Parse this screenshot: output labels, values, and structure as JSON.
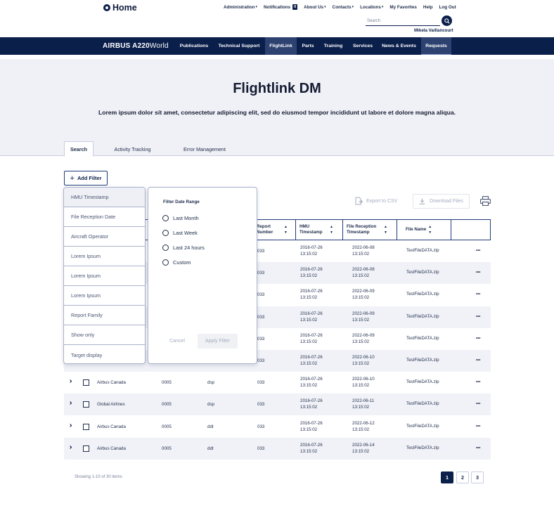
{
  "topbar": {
    "logo_text": "Home",
    "nav": [
      "Administration",
      "Notifications",
      "About Us",
      "Contacts",
      "Locations",
      "My Favorites",
      "Help",
      "Log Out"
    ],
    "notifications_count": "0",
    "search_placeholder": "Search",
    "user_name": "Mikela Vaillancourt"
  },
  "mainnav": {
    "brand_bold": "AIRBUS A220",
    "brand_light": "World",
    "items": [
      "Publications",
      "Technical Support",
      "FlightLink",
      "Parts",
      "Training",
      "Services",
      "News & Events",
      "Requests"
    ],
    "active_item": "FlightLink"
  },
  "hero": {
    "title": "Flightlink DM",
    "subtitle": "Lorem ipsum dolor sit amet, consectetur adipiscing elit, sed do eiusmod tempor incididunt ut labore et dolore magna aliqua."
  },
  "tabs": [
    "Search",
    "Activity Tracking",
    "Error Management"
  ],
  "add_filter_label": "Add Filter",
  "actions": {
    "export_label": "Export to CSV",
    "download_label": "Download Files"
  },
  "table": {
    "headers": {
      "report_number": "Report Number",
      "hmu_timestamp": "HMU Timestamp",
      "file_reception": "File Reception Timestamp",
      "file_name": "File Name"
    },
    "rows": [
      {
        "operator": "",
        "code": "",
        "type": "",
        "report": "033",
        "hmu_date": "2016-07-26",
        "hmu_time": "13:15:02",
        "rec_date": "2022-06-08",
        "rec_time": "13:15:02",
        "file": "TestFileDATA.zip"
      },
      {
        "operator": "",
        "code": "",
        "type": "",
        "report": "033",
        "hmu_date": "2016-07-26",
        "hmu_time": "13:15:02",
        "rec_date": "2022-06-08",
        "rec_time": "13:15:02",
        "file": "TestFileDATA.zip"
      },
      {
        "operator": "",
        "code": "",
        "type": "",
        "report": "033",
        "hmu_date": "2016-07-26",
        "hmu_time": "13:15:02",
        "rec_date": "2022-06-09",
        "rec_time": "13:15:02",
        "file": "TestFileDATA.zip"
      },
      {
        "operator": "",
        "code": "",
        "type": "",
        "report": "033",
        "hmu_date": "2016-07-26",
        "hmu_time": "13:15:02",
        "rec_date": "2022-06-09",
        "rec_time": "13:15:02",
        "file": "TestFileDATA.zip"
      },
      {
        "operator": "",
        "code": "",
        "type": "",
        "report": "033",
        "hmu_date": "2016-07-26",
        "hmu_time": "13:15:02",
        "rec_date": "2022-06-09",
        "rec_time": "13:15:02",
        "file": "TestFileDATA.zip"
      },
      {
        "operator": "",
        "code": "",
        "type": "",
        "report": "033",
        "hmu_date": "2016-07-26",
        "hmu_time": "13:15:02",
        "rec_date": "2022-06-10",
        "rec_time": "13:15:02",
        "file": "TestFileDATA.zip"
      },
      {
        "operator": "Airbus Canada",
        "code": "0005",
        "type": "dsp",
        "report": "033",
        "hmu_date": "2016-07-26",
        "hmu_time": "13:15:02",
        "rec_date": "2022-06-10",
        "rec_time": "13:15:02",
        "file": "TestFileDATA.zip"
      },
      {
        "operator": "Global Airlines",
        "code": "0005",
        "type": "dsp",
        "report": "033",
        "hmu_date": "2016-07-26",
        "hmu_time": "13:15:02",
        "rec_date": "2022-06-11",
        "rec_time": "13:15:02",
        "file": "TestFileDATA.zip"
      },
      {
        "operator": "Airbus Canada",
        "code": "0005",
        "type": "ddt",
        "report": "033",
        "hmu_date": "2016-07-26",
        "hmu_time": "13:15:02",
        "rec_date": "2022-06-12",
        "rec_time": "13:15:02",
        "file": "TestFileDATA.zip"
      },
      {
        "operator": "Airbus Canada",
        "code": "0005",
        "type": "ddt",
        "report": "033",
        "hmu_date": "2016-07-26",
        "hmu_time": "13:15:02",
        "rec_date": "2022-06-14",
        "rec_time": "13:15:02",
        "file": "TestFileDATA.zip"
      }
    ]
  },
  "filter_menu": {
    "items": [
      "HMU Timestamp",
      "File Reception Date",
      "Aircraft Operator",
      "Lorem Ipsum",
      "Lorem Ipsum",
      "Lorem Ipsum",
      "Report Family",
      "Show only",
      "Target display"
    ],
    "panel_title": "Filter Date Range",
    "options": [
      "Last Month",
      "Last Week",
      "Last 24 hours",
      "Custom"
    ],
    "cancel_label": "Cancel",
    "apply_label": "Apply Filter"
  },
  "footer": {
    "showing": "Showing 1-10 of 30 items",
    "pages": [
      "1",
      "2",
      "3"
    ],
    "current_page": "1"
  },
  "colors": {
    "navy": "#0b1f4b",
    "nav_active": "#2e4271",
    "hero_bg": "#f0f1f6",
    "row_alt": "#f0f2f7"
  }
}
